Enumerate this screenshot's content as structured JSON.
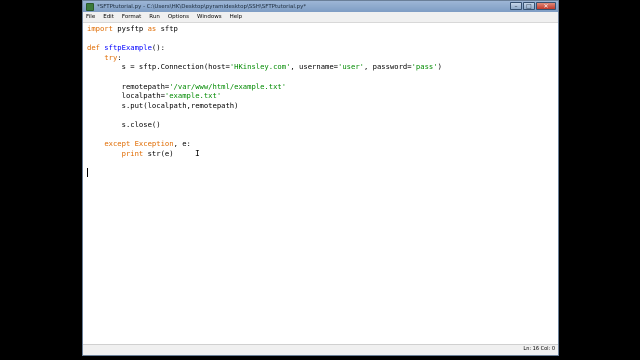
{
  "window": {
    "title": "*SFTPtutorial.py - C:\\Users\\HK\\Desktop\\pyramidesktop\\SSH\\SFTPtutorial.py*",
    "controls": {
      "minimize": "–",
      "maximize": "□",
      "close": "✕"
    }
  },
  "menu": [
    "File",
    "Edit",
    "Format",
    "Run",
    "Options",
    "Windows",
    "Help"
  ],
  "code": {
    "line1": {
      "kw1": "import",
      "t1": " pysftp ",
      "kw2": "as",
      "t2": " sftp"
    },
    "line3": {
      "kw": "def",
      "fn": " sftpExample",
      "t": "():"
    },
    "line4": {
      "indent": "    ",
      "kw": "try",
      "t": ":"
    },
    "line5": {
      "indent": "        ",
      "t1": "s = sftp.Connection(host=",
      "s1": "'HKinsley.com'",
      "t2": ", username=",
      "s2": "'user'",
      "t3": ", password=",
      "s3": "'pass'",
      "t4": ")"
    },
    "line7": {
      "indent": "        ",
      "t": "remotepath=",
      "s": "'/var/www/html/example.txt'"
    },
    "line8": {
      "indent": "        ",
      "t": "localpath=",
      "s": "'example.txt'"
    },
    "line9": {
      "indent": "        ",
      "t": "s.put(localpath,remotepath)"
    },
    "line11": {
      "indent": "        ",
      "t": "s.close()"
    },
    "line13": {
      "indent": "    ",
      "kw1": "except",
      "t1": " ",
      "kw2": "Exception",
      "t2": ", e:"
    },
    "line14": {
      "indent": "        ",
      "kw": "print",
      "t": " str(e)"
    }
  },
  "colors": {
    "keyword": "#e06b00",
    "function": "#0000ff",
    "string": "#008a00",
    "text": "#000000"
  },
  "status": {
    "position": "Ln: 16 Col: 0"
  }
}
